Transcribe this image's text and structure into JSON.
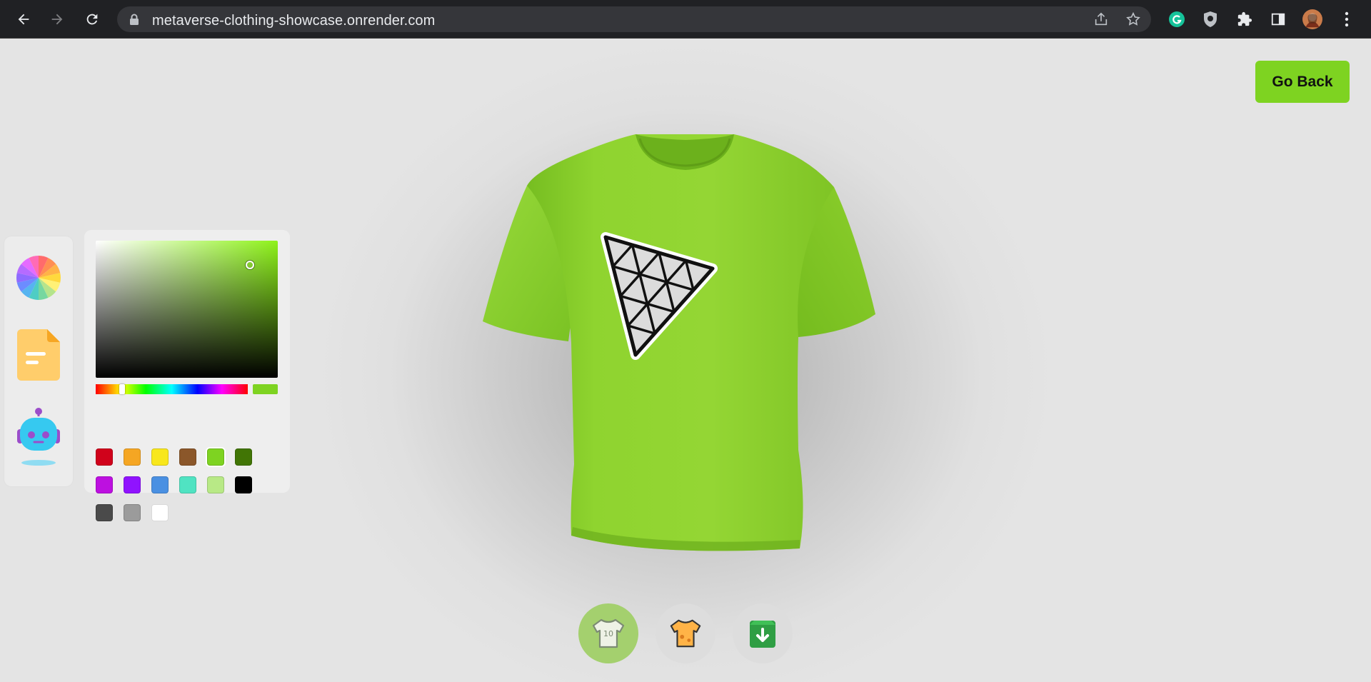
{
  "browser": {
    "url": "metaverse-clothing-showcase.onrender.com",
    "icons": [
      "back-arrow-icon",
      "forward-arrow-icon",
      "reload-icon",
      "lock-icon",
      "share-icon",
      "star-icon",
      "grammarly-icon",
      "shield-icon",
      "puzzle-icon",
      "side-panel-icon",
      "avatar",
      "more-vert-icon"
    ]
  },
  "header": {
    "go_back_label": "Go Back"
  },
  "tools": [
    {
      "name": "color-picker",
      "icon": "color-wheel-icon"
    },
    {
      "name": "file-picker",
      "icon": "document-icon"
    },
    {
      "name": "ai-picker",
      "icon": "robot-icon"
    }
  ],
  "color_picker": {
    "selected_color": "#7ed321",
    "swatches": [
      "#d0021b",
      "#f5a623",
      "#f8e71c",
      "#8b572a",
      "#7ed321",
      "#417505",
      "#bd10e0",
      "#9013fe",
      "#4a90e2",
      "#50e3c2",
      "#b8e986",
      "#000000",
      "#4a4a4a",
      "#9b9b9b",
      "#ffffff"
    ]
  },
  "shirt": {
    "color": "#8ed22e",
    "decal": "triangle-logo"
  },
  "filter_tabs": [
    {
      "name": "logo-shirt",
      "icon": "logo-shirt-icon",
      "active": true
    },
    {
      "name": "stylish-shirt",
      "icon": "stylish-shirt-icon",
      "active": false
    },
    {
      "name": "download",
      "icon": "download-icon",
      "active": false
    }
  ]
}
